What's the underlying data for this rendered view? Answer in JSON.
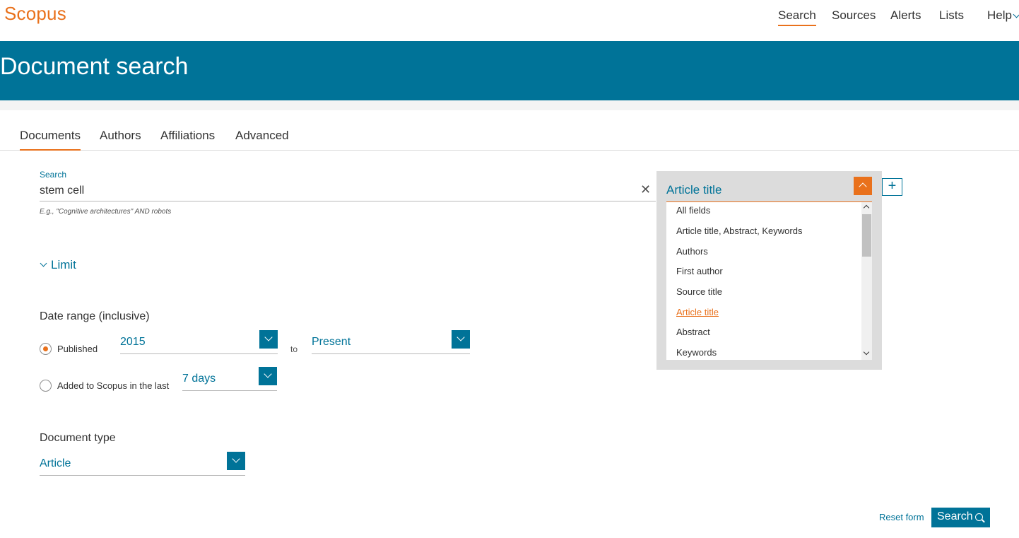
{
  "app": {
    "logo": "Scopus"
  },
  "topnav": {
    "items": [
      "Search",
      "Sources",
      "Alerts",
      "Lists",
      "Help"
    ],
    "active": "Search"
  },
  "banner": {
    "title": "Document search"
  },
  "tabs": {
    "items": [
      "Documents",
      "Authors",
      "Affiliations",
      "Advanced"
    ],
    "active": "Documents"
  },
  "search": {
    "label": "Search",
    "value": "stem cell",
    "clear_icon": "close-icon",
    "example": "E.g., \"Cognitive architectures\" AND robots"
  },
  "field": {
    "selected": "Article title",
    "options": [
      "All fields",
      "Article title, Abstract, Keywords",
      "Authors",
      "First author",
      "Source title",
      "Article title",
      "Abstract",
      "Keywords"
    ],
    "add_label": "+"
  },
  "limit": {
    "label": "Limit"
  },
  "date_range": {
    "heading": "Date range (inclusive)",
    "published_label": "Published",
    "from": "2015",
    "to_label": "to",
    "to": "Present",
    "added_label": "Added to Scopus in the last",
    "added_value": "7 days",
    "selected": "published"
  },
  "document_type": {
    "heading": "Document type",
    "value": "Article"
  },
  "actions": {
    "reset": "Reset form",
    "search": "Search"
  },
  "colors": {
    "accent": "#e9711c",
    "primary": "#007398"
  }
}
